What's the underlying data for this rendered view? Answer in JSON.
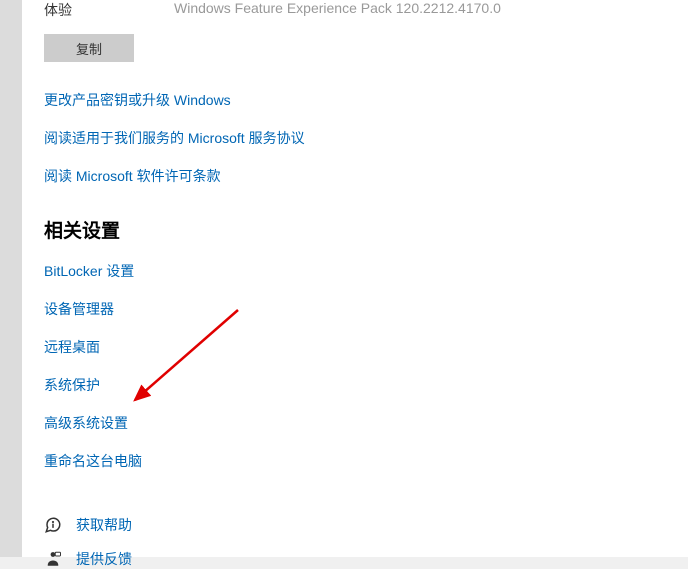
{
  "spec": {
    "label": "体验",
    "value": "Windows Feature Experience Pack 120.2212.4170.0"
  },
  "copy_button": "复制",
  "windows_links": [
    "更改产品密钥或升级 Windows",
    "阅读适用于我们服务的 Microsoft 服务协议",
    "阅读 Microsoft 软件许可条款"
  ],
  "related_heading": "相关设置",
  "related_links": [
    "BitLocker 设置",
    "设备管理器",
    "远程桌面",
    "系统保护",
    "高级系统设置",
    "重命名这台电脑"
  ],
  "help": {
    "get_help": "获取帮助",
    "feedback": "提供反馈"
  }
}
